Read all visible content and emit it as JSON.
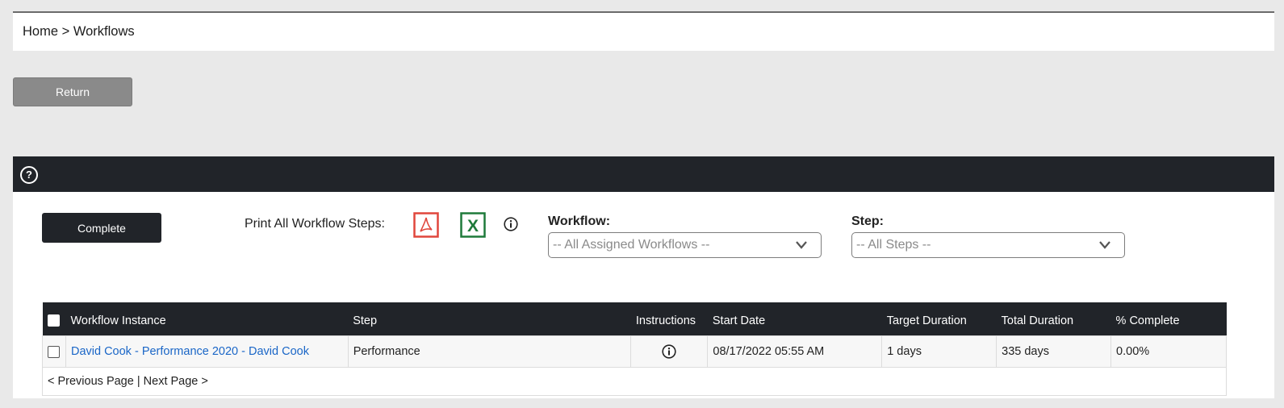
{
  "breadcrumb": {
    "home": "Home",
    "separator": ">",
    "current": "Workflows"
  },
  "return_label": "Return",
  "header": {
    "help_icon": "question-circle-icon"
  },
  "toolbar": {
    "complete_label": "Complete",
    "print_label": "Print All Workflow Steps:",
    "pdf_icon": "pdf-icon",
    "excel_icon": "excel-icon",
    "info_icon": "info-icon"
  },
  "filters": {
    "workflow": {
      "label": "Workflow:",
      "value": "-- All Assigned Workflows --"
    },
    "step": {
      "label": "Step:",
      "value": "-- All Steps --"
    }
  },
  "table": {
    "columns": [
      "Workflow Instance",
      "Step",
      "Instructions",
      "Start Date",
      "Target Duration",
      "Total Duration",
      "% Complete"
    ],
    "rows": [
      {
        "instance": "David Cook - Performance 2020 - David Cook",
        "step": "Performance",
        "instructions_icon": "info-icon",
        "start_date": "08/17/2022 05:55 AM",
        "target_duration": "1 days",
        "total_duration": "335 days",
        "percent_complete": "0.00%"
      }
    ]
  },
  "pager": {
    "previous": "< Previous Page",
    "separator": "|",
    "next": "Next Page >"
  },
  "colors": {
    "dark": "#212429",
    "link": "#1a66c7",
    "pdf": "#e0463c",
    "excel": "#1e7a3a",
    "return_bg": "#8a8a8a"
  }
}
